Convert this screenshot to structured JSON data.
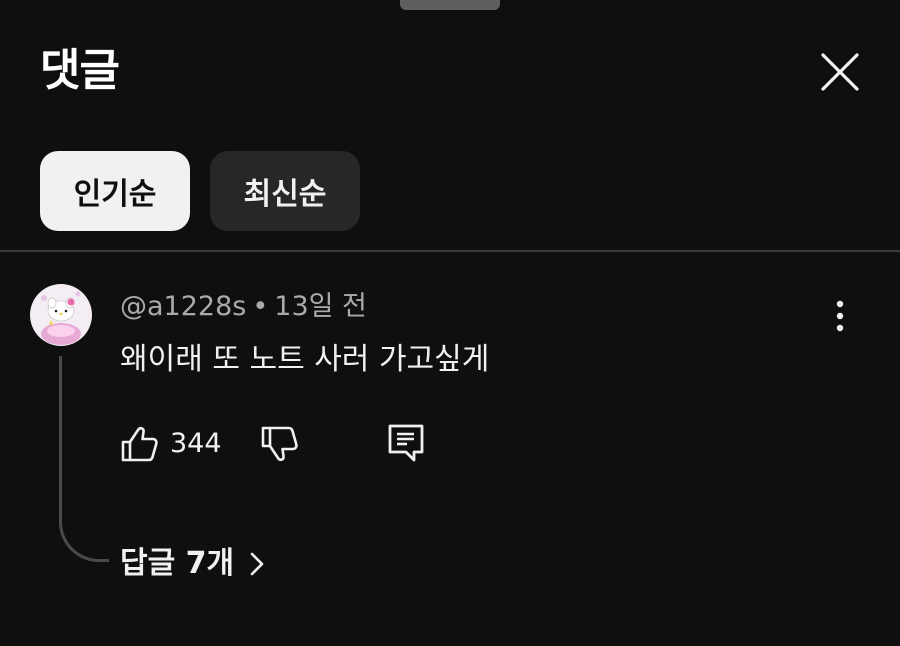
{
  "header": {
    "title": "댓글",
    "close_icon": "close-icon"
  },
  "sort_chips": [
    {
      "label": "인기순",
      "selected": true
    },
    {
      "label": "최신순",
      "selected": false
    }
  ],
  "comment": {
    "author": "@a1228s",
    "separator": "•",
    "time": "13일 전",
    "text": "왜이래 또 노트 사러 가고싶게",
    "like_count": "344",
    "replies_label": "답글 7개",
    "avatar_icon": "hello-kitty-avatar"
  },
  "colors": {
    "background": "#0f0f0f",
    "chip_selected_bg": "#f1f1f1",
    "chip_bg": "#272727",
    "meta_text": "#aaaaaa",
    "primary_text": "#f1f1f1"
  }
}
